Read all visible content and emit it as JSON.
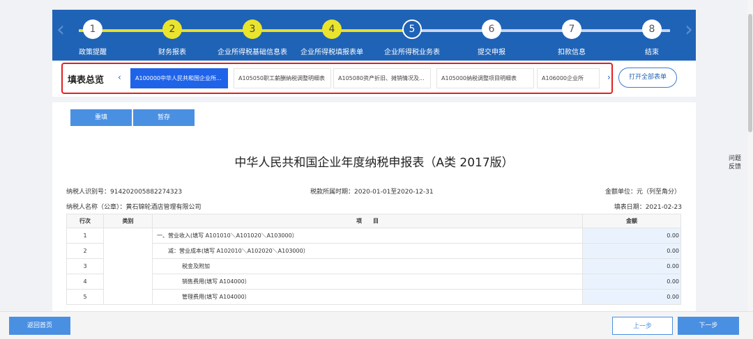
{
  "stepper": {
    "steps": [
      {
        "num": "1",
        "label": "政策提醒",
        "state": "normal"
      },
      {
        "num": "2",
        "label": "财务报表",
        "state": "done"
      },
      {
        "num": "3",
        "label": "企业所得税基础信息表",
        "state": "done"
      },
      {
        "num": "4",
        "label": "企业所得税填报表单",
        "state": "done"
      },
      {
        "num": "5",
        "label": "企业所得税业务表",
        "state": "current"
      },
      {
        "num": "6",
        "label": "提交申报",
        "state": "normal"
      },
      {
        "num": "7",
        "label": "扣款信息",
        "state": "normal"
      },
      {
        "num": "8",
        "label": "结束",
        "state": "normal"
      }
    ]
  },
  "tabs": {
    "title": "填表总览",
    "items": [
      {
        "label": "A100000中华人民共和国企业所...",
        "active": true
      },
      {
        "label": "A105050职工薪酬纳税调整明细表",
        "active": false
      },
      {
        "label": "A105080资产折旧、摊销情况及...",
        "active": false
      },
      {
        "label": "A105000纳税调整项目明细表",
        "active": false
      },
      {
        "label": "A106000企业所",
        "active": false
      }
    ],
    "open_all": "打开全部表单"
  },
  "toolbar": {
    "reset": "重填",
    "save": "暂存"
  },
  "doc": {
    "title": "中华人民共和国企业年度纳税申报表（A类 2017版）",
    "taxpayer_id": "纳税人识别号：914202005882274323",
    "period": "税款所属时期：2020-01-01至2020-12-31",
    "unit": "金额单位：元（列至角分）",
    "taxpayer_name": "纳税人名称（公章）：黄石锦轮酒店管理有限公司",
    "fill_date": "填表日期：2021-02-23"
  },
  "table": {
    "headers": {
      "row": "行次",
      "category": "类别",
      "item": "项　　目",
      "amount": "金额"
    },
    "rows": [
      {
        "row": "1",
        "item": "一、营业收入(填写 A101010＼A101020＼A103000）",
        "amount": "0.00",
        "indent": 0
      },
      {
        "row": "2",
        "item": "减：营业成本(填写 A102010＼A102020＼A103000）",
        "amount": "0.00",
        "indent": 1
      },
      {
        "row": "3",
        "item": "税金及附加",
        "amount": "0.00",
        "indent": 2
      },
      {
        "row": "4",
        "item": "销售费用(填写 A104000）",
        "amount": "0.00",
        "indent": 2
      },
      {
        "row": "5",
        "item": "管理费用(填写 A104000）",
        "amount": "0.00",
        "indent": 2
      }
    ]
  },
  "bottom": {
    "home": "返回首页",
    "prev": "上一步",
    "next": "下一步"
  },
  "feedback": {
    "line1": "问题",
    "line2": "反馈"
  }
}
